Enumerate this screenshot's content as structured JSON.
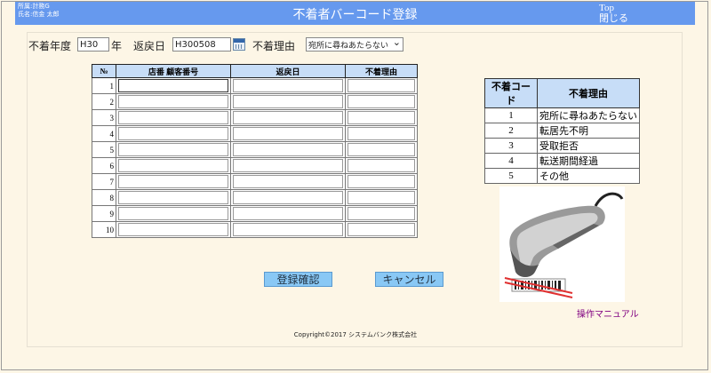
{
  "header": {
    "user_line1": "所属:計務G",
    "user_line2": "氏名:信金 太郎",
    "title": "不着者バーコード登録",
    "link_top": "Top",
    "link_close": "閉じる"
  },
  "filters": {
    "year_label": "不着年度",
    "year_value": "H30",
    "year_suffix": "年",
    "return_label": "返戻日",
    "return_value": "H300508",
    "reason_label": "不着理由",
    "reason_selected": "宛所に尋ねあたらない"
  },
  "table": {
    "headers": [
      "№",
      "店番 顧客番号",
      "返戻日",
      "不着理由"
    ],
    "rows": [
      "1",
      "2",
      "3",
      "4",
      "5",
      "6",
      "7",
      "8",
      "9",
      "10"
    ]
  },
  "codes": {
    "headers": [
      "不着コード",
      "不着理由"
    ],
    "rows": [
      {
        "code": "1",
        "reason": "宛所に尋ねあたらない"
      },
      {
        "code": "2",
        "reason": "転居先不明"
      },
      {
        "code": "3",
        "reason": "受取拒否"
      },
      {
        "code": "4",
        "reason": "転送期間経過"
      },
      {
        "code": "5",
        "reason": "その他"
      }
    ]
  },
  "buttons": {
    "confirm": "登録確認",
    "cancel": "キャンセル"
  },
  "manual_link": "操作マニュアル",
  "copyright": "Copyright©2017 システムバンク株式会社",
  "colors": {
    "header_bg": "#6699ee",
    "table_header_bg": "#c7ddf7",
    "button_bg": "#89c8f5",
    "page_bg": "#fdf6e6"
  }
}
